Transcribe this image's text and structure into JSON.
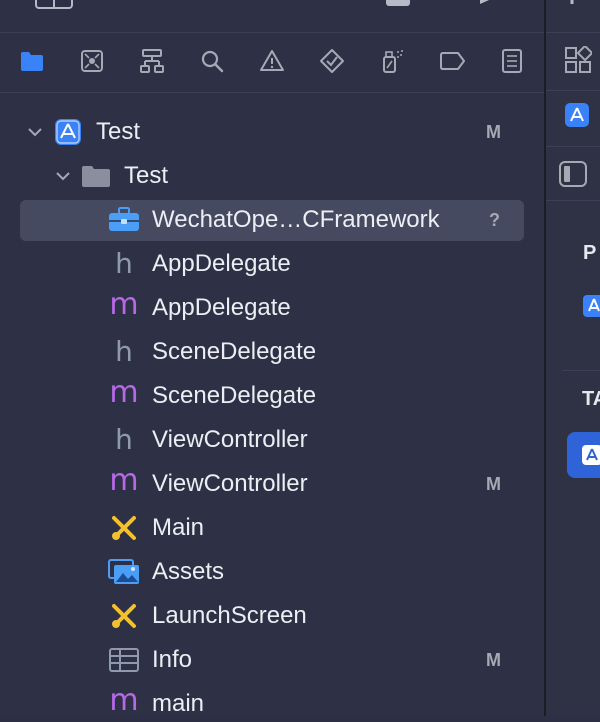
{
  "navigator": {
    "tabs": [
      {
        "name": "folder-icon",
        "active": true
      },
      {
        "name": "source-control-icon"
      },
      {
        "name": "symbol-hierarchy-icon"
      },
      {
        "name": "search-icon"
      },
      {
        "name": "warning-icon"
      },
      {
        "name": "test-diamond-icon"
      },
      {
        "name": "debug-spray-icon"
      },
      {
        "name": "breakpoint-icon"
      },
      {
        "name": "report-list-icon"
      }
    ],
    "tree": [
      {
        "label": "Test",
        "badge": "M",
        "kind": "project"
      },
      {
        "label": "Test",
        "badge": "",
        "kind": "folder"
      },
      {
        "label": "WechatOpe…CFramework",
        "badge": "?",
        "kind": "framework"
      },
      {
        "label": "AppDelegate",
        "badge": "",
        "kind": "h"
      },
      {
        "label": "AppDelegate",
        "badge": "",
        "kind": "m"
      },
      {
        "label": "SceneDelegate",
        "badge": "",
        "kind": "h"
      },
      {
        "label": "SceneDelegate",
        "badge": "",
        "kind": "m"
      },
      {
        "label": "ViewController",
        "badge": "",
        "kind": "h"
      },
      {
        "label": "ViewController",
        "badge": "M",
        "kind": "m"
      },
      {
        "label": "Main",
        "badge": "",
        "kind": "storyboard"
      },
      {
        "label": "Assets",
        "badge": "",
        "kind": "assets"
      },
      {
        "label": "LaunchScreen",
        "badge": "",
        "kind": "storyboard"
      },
      {
        "label": "Info",
        "badge": "M",
        "kind": "plist"
      },
      {
        "label": "main",
        "badge": "",
        "kind": "m"
      }
    ]
  },
  "inspector": {
    "section_1": "P",
    "section_2": "TA"
  },
  "colors": {
    "accent": "#3a82f7",
    "m_file": "#b569e6",
    "h_file": "#8f9ab0",
    "storyboard": "#f2c12e"
  }
}
